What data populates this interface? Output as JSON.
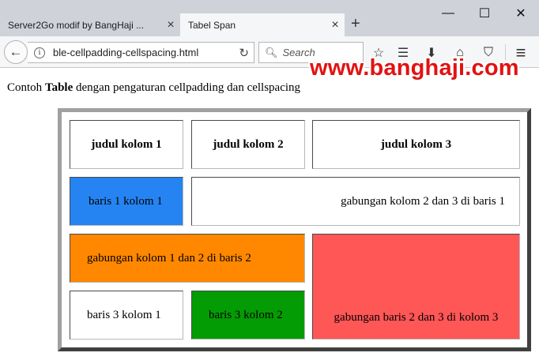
{
  "window": {
    "minimize_glyph": "—",
    "maximize_glyph": "☐",
    "close_glyph": "✕"
  },
  "tabs": [
    {
      "title": "Server2Go modif by BangHaji ...",
      "active": false
    },
    {
      "title": "Tabel Span",
      "active": true
    }
  ],
  "glyphs": {
    "tab_close": "×",
    "new_tab": "+",
    "back": "←",
    "info": "i",
    "reload": "↻",
    "search": "🔍︎",
    "bookmark_star": "☆",
    "reader_list": "☰",
    "download": "⬇",
    "home": "⌂",
    "pocket": "⛉",
    "menu": "≡"
  },
  "toolbar": {
    "url": "ble-cellpadding-cellspacing.html",
    "search_placeholder": "Search"
  },
  "watermark": "www.banghaji.com",
  "page": {
    "intro_prefix": "Contoh ",
    "intro_bold": "Table",
    "intro_suffix": " dengan pengaturan cellpadding dan cellspacing"
  },
  "table": {
    "headers": [
      "judul kolom 1",
      "judul kolom 2",
      "judul kolom 3"
    ],
    "row1": {
      "col1": "baris 1 kolom 1",
      "col23": "gabungan kolom 2 dan 3 di baris 1"
    },
    "row2": {
      "col12": "gabungan kolom 1 dan 2 di baris 2"
    },
    "row3": {
      "col1": "baris 3 kolom 1",
      "col2": "baris 3 kolom 2"
    },
    "rowspan_cell": "gabungan baris 2 dan 3 di kolom 3",
    "colors": {
      "blue_cell": "#2584f1",
      "orange_cell": "#ff8800",
      "red_cell": "#ff5656",
      "green_cell": "#049c04"
    }
  }
}
